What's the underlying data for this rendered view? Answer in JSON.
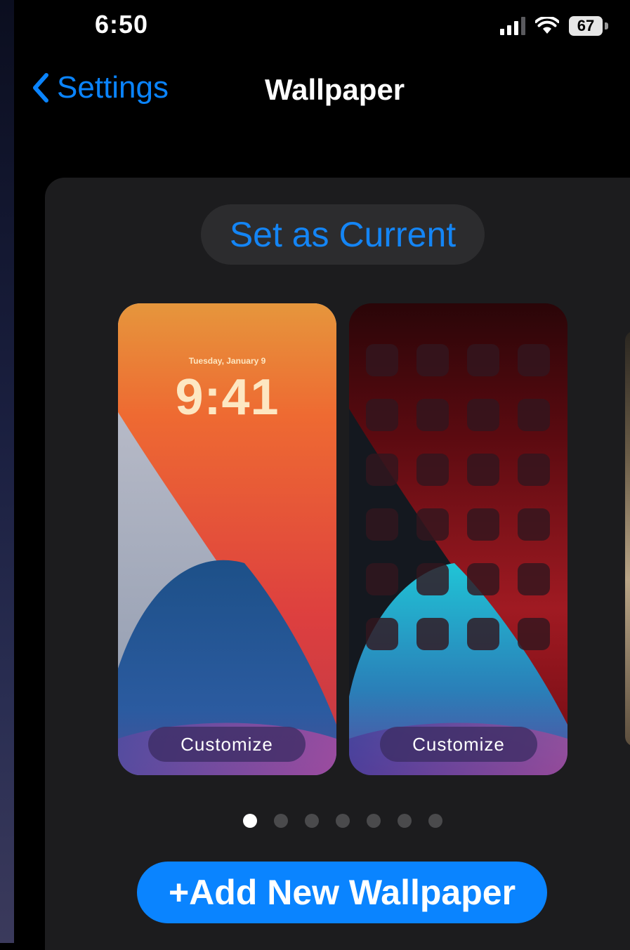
{
  "status_bar": {
    "time": "6:50",
    "battery_level": "67"
  },
  "nav": {
    "back_label": "Settings",
    "title": "Wallpaper"
  },
  "card": {
    "set_current_label": "Set as Current",
    "lock_preview": {
      "date": "Tuesday, January 9",
      "time": "9:41",
      "customize_label": "Customize"
    },
    "home_preview": {
      "customize_label": "Customize"
    },
    "page_dots": {
      "total": 7,
      "active": 1
    },
    "add_new_label": "+Add New Wallpaper"
  },
  "colors": {
    "accent": "#0a84ff",
    "card_bg": "#1c1c1e",
    "pill_bg": "#2c2c2e"
  },
  "icons": [
    "cellular-signal-icon",
    "wifi-icon",
    "battery-icon",
    "chevron-left-icon"
  ]
}
